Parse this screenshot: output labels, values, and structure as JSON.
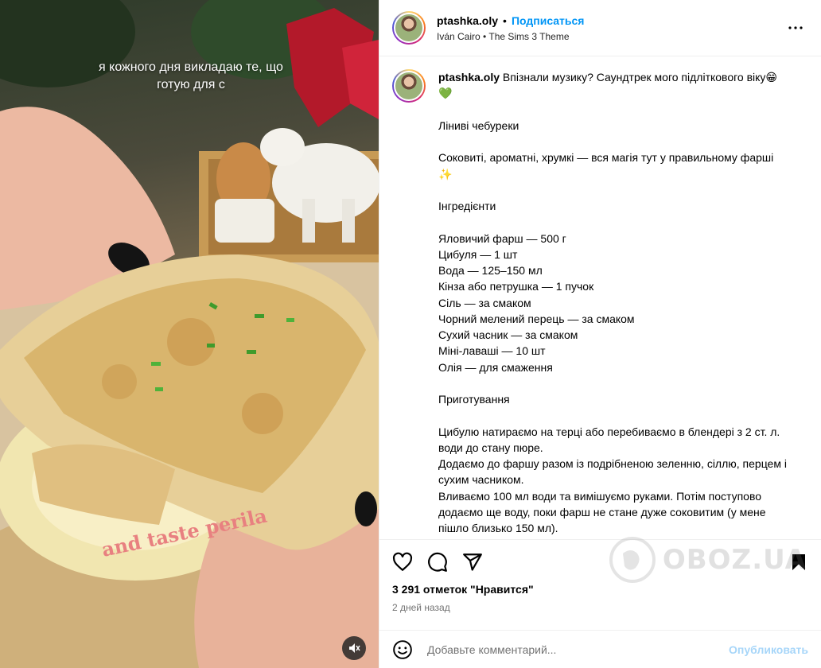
{
  "media": {
    "overlay_text": "я кожного дня викладаю те, що\nготую для с",
    "plate_text": "and taste perila"
  },
  "header": {
    "username": "ptashka.oly",
    "separator": "•",
    "follow_label": "Подписаться",
    "audio_artist": "Iván Cairo",
    "audio_separator": "•",
    "audio_track": "The Sims 3 Theme"
  },
  "caption": {
    "username": "ptashka.oly",
    "intro": "Впізнали музику? Саундтрек мого підліткового віку😁 💚",
    "body": "\nЛіниві чебуреки\n\nСоковиті, ароматні, хрумкі — вся магія тут у правильному фарші ✨\n\nІнгредієнти\n\nЯловичий фарш — 500 г\nЦибуля — 1 шт\nВода — 125–150 мл\nКінза або петрушка — 1 пучок\nСіль — за смаком\nЧорний мелений перець — за смаком\nСухий часник — за смаком\nМіні-лаваші — 10 шт\nОлія — для смаження\n\nПриготування\n\nЦибулю натираємо на терці або перебиваємо в блендері з 2 ст. л. води до стану пюре.\nДодаємо до фаршу разом із подрібненою зеленню, сіллю, перцем і сухим часником.\nВливаємо 100 мл води та вимішуємо руками. Потім поступово додаємо ще воду, поки фарш не стане дуже соковитим (у мене пішло близько 150 мл)."
  },
  "actions": {
    "likes": "3 291 отметок \"Нравится\"",
    "date": "2 дней назад"
  },
  "comment_box": {
    "placeholder": "Добавьте комментарий...",
    "publish_label": "Опубликовать"
  },
  "watermark": {
    "text": "OBOZ.UA"
  },
  "icons": {
    "like": "heart-icon",
    "comment": "comment-icon",
    "share": "share-icon",
    "save": "bookmark-icon",
    "more": "more-icon",
    "emoji": "emoji-icon",
    "mute": "mute-icon"
  },
  "colors": {
    "follow": "#0095f6",
    "publish_disabled": "#a7d6f9",
    "muted_text": "#737373"
  }
}
